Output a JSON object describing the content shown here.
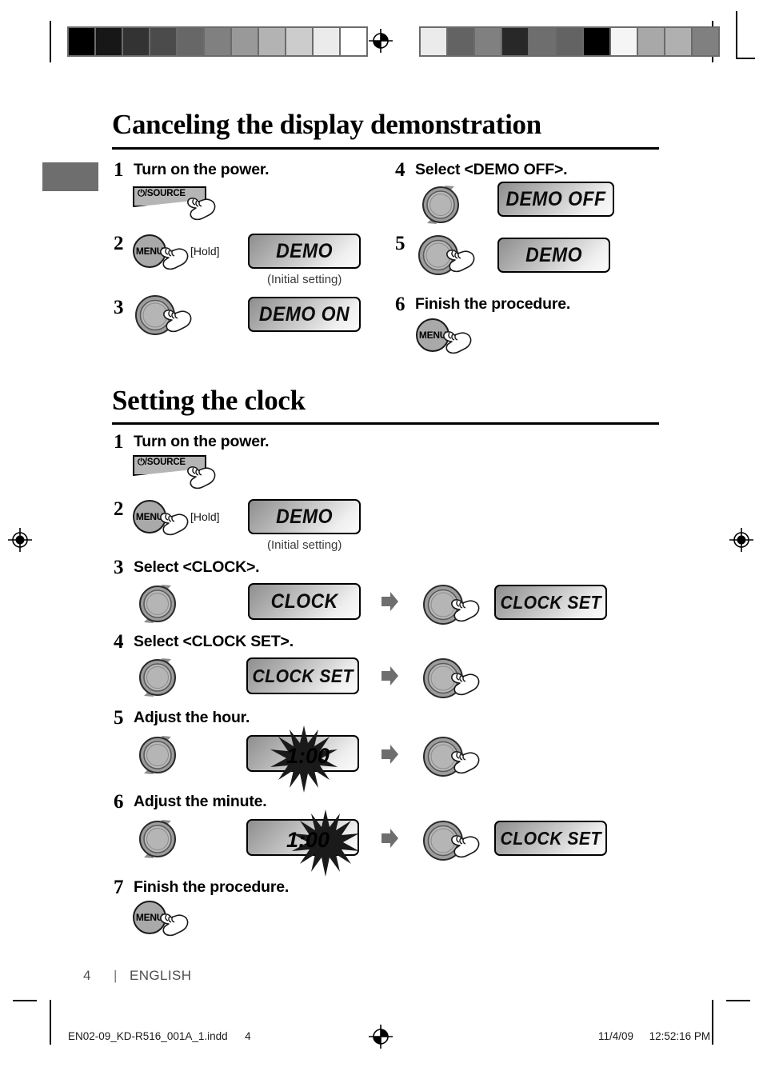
{
  "document": {
    "page_number": "4",
    "separator": "|",
    "language": "ENGLISH",
    "print_filename": "EN02-09_KD-R516_001A_1.indd",
    "print_page": "4",
    "print_date": "11/4/09",
    "print_time": "12:52:16 PM"
  },
  "calibration": {
    "left_bar_swatches": [
      "#000000",
      "#171717",
      "#333333",
      "#4b4b4b",
      "#676767",
      "#808080",
      "#999999",
      "#b3b3b3",
      "#cccccc",
      "#ebebeb",
      "#ffffff"
    ],
    "right_bar_swatches": [
      "#ebebeb",
      "#636363",
      "#808080",
      "#282828",
      "#6e6e6e",
      "#636363",
      "#000000",
      "#f5f5f5",
      "#a8a8a8",
      "#b0b0b0",
      "#808080"
    ]
  },
  "sections": [
    {
      "id": "canceling-demo",
      "title": "Canceling the display demonstration",
      "steps": [
        {
          "num": "1",
          "text": "Turn on the power.",
          "control": "power-source-button",
          "control_label": "/SOURCE"
        },
        {
          "num": "2",
          "text": "",
          "control": "menu-button",
          "control_label": "MENU",
          "hold": "[Hold]",
          "display": "DEMO",
          "note": "(Initial setting)"
        },
        {
          "num": "3",
          "text": "",
          "control": "knob-press",
          "display": "DEMO ON"
        },
        {
          "num": "4",
          "text": "Select <DEMO OFF>.",
          "control": "knob-rotate",
          "display": "DEMO OFF"
        },
        {
          "num": "5",
          "text": "",
          "control": "knob-press",
          "display": "DEMO"
        },
        {
          "num": "6",
          "text": "Finish the procedure.",
          "control": "menu-button",
          "control_label": "MENU"
        }
      ]
    },
    {
      "id": "setting-clock",
      "title": "Setting the clock",
      "steps": [
        {
          "num": "1",
          "text": "Turn on the power.",
          "control": "power-source-button",
          "control_label": "/SOURCE"
        },
        {
          "num": "2",
          "text": "",
          "control": "menu-button",
          "control_label": "MENU",
          "hold": "[Hold]",
          "display": "DEMO",
          "note": "(Initial setting)"
        },
        {
          "num": "3",
          "text": "Select <CLOCK>.",
          "control": "knob-rotate",
          "display": "CLOCK",
          "display2": "CLOCK SET"
        },
        {
          "num": "4",
          "text": "Select <CLOCK SET>.",
          "control": "knob-rotate",
          "display": "CLOCK SET",
          "display2": ""
        },
        {
          "num": "5",
          "text": "Adjust the hour.",
          "control": "knob-rotate",
          "display": "1:00",
          "blink": "hour"
        },
        {
          "num": "6",
          "text": "Adjust the minute.",
          "control": "knob-rotate",
          "display": "1:00",
          "blink": "minute",
          "display2": "CLOCK SET"
        },
        {
          "num": "7",
          "text": "Finish the procedure.",
          "control": "menu-button",
          "control_label": "MENU"
        }
      ]
    }
  ]
}
